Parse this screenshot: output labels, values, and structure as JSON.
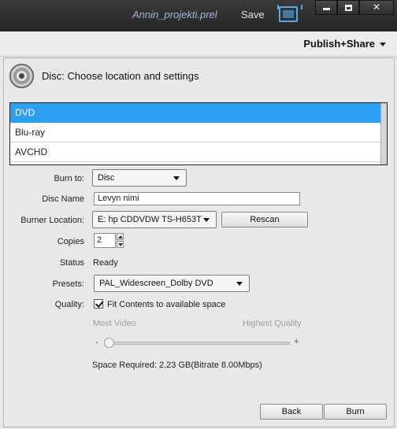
{
  "titlebar": {
    "project_title": "Annin_projekti.prel",
    "save_label": "Save",
    "minimize": "",
    "maximize": "",
    "close": "✕"
  },
  "publish": {
    "label": "Publish+Share"
  },
  "panel": {
    "heading": "Disc: Choose location and settings",
    "disc_types": [
      "DVD",
      "Blu-ray",
      "AVCHD"
    ],
    "selected_disc_type": "DVD"
  },
  "form": {
    "burn_to_label": "Burn to:",
    "burn_to_value": "Disc",
    "disc_name_label": "Disc Name",
    "disc_name_value": "Levyn nimi",
    "burner_location_label": "Burner Location:",
    "burner_location_value": "E: hp CDDVDW TS-H653T",
    "rescan_label": "Rescan",
    "copies_label": "Copies",
    "copies_value": "2",
    "status_label": "Status",
    "status_value": "Ready",
    "presets_label": "Presets:",
    "presets_value": "PAL_Widescreen_Dolby DVD",
    "quality_label": "Quality:",
    "fit_contents_label": "Fit Contents to available space",
    "fit_contents_checked": true,
    "most_video_label": "Most Video",
    "highest_quality_label": "Highest Quality",
    "slider_minus": "-",
    "slider_plus": "+",
    "quality_slider_value": 0,
    "space_required": "Space Required: 2.23 GB(Bitrate 8.00Mbps)"
  },
  "footer": {
    "back_label": "Back",
    "burn_label": "Burn"
  },
  "colors": {
    "selection": "#2c9ff0",
    "title_accent": "#9fb7d6",
    "monitor_icon": "#5aa9ea"
  }
}
